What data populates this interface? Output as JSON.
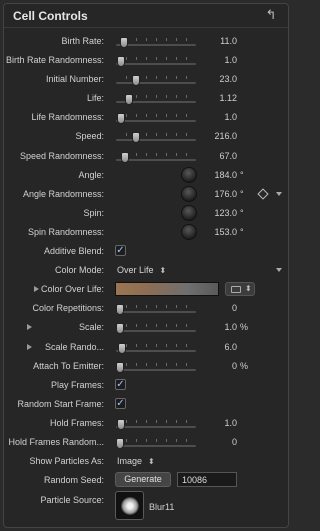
{
  "header": {
    "title": "Cell Controls",
    "reset_icon": "reset-arrow-icon",
    "reset_glyph": "↰"
  },
  "rows": {
    "birth_rate": {
      "label": "Birth Rate:",
      "value": "11.0",
      "slider_pos": 0.05
    },
    "birth_rate_randomness": {
      "label": "Birth Rate Randomness:",
      "value": "1.0",
      "slider_pos": 0.02
    },
    "initial_number": {
      "label": "Initial Number:",
      "value": "23.0",
      "slider_pos": 0.22
    },
    "life": {
      "label": "Life:",
      "value": "1.12",
      "slider_pos": 0.13
    },
    "life_randomness": {
      "label": "Life Randomness:",
      "value": "1.0",
      "slider_pos": 0.02
    },
    "speed": {
      "label": "Speed:",
      "value": "216.0",
      "slider_pos": 0.22
    },
    "speed_randomness": {
      "label": "Speed Randomness:",
      "value": "67.0",
      "slider_pos": 0.07
    },
    "angle": {
      "label": "Angle:",
      "value": "184.0",
      "unit": "°"
    },
    "angle_randomness": {
      "label": "Angle Randomness:",
      "value": "176.0",
      "unit": "°"
    },
    "spin": {
      "label": "Spin:",
      "value": "123.0",
      "unit": "°"
    },
    "spin_randomness": {
      "label": "Spin Randomness:",
      "value": "153.0",
      "unit": "°"
    },
    "additive_blend": {
      "label": "Additive Blend:",
      "checked": true
    },
    "color_mode": {
      "label": "Color Mode:",
      "value": "Over Life"
    },
    "color_over_life": {
      "label": "Color Over Life:"
    },
    "color_repetitions": {
      "label": "Color Repetitions:",
      "value": "0",
      "slider_pos": 0.0
    },
    "scale": {
      "label": "Scale:",
      "value": "1.0",
      "unit": "%",
      "slider_pos": 0.0
    },
    "scale_randomness": {
      "label": "Scale Rando...",
      "value": "6.0",
      "slider_pos": 0.03
    },
    "attach_to_emitter": {
      "label": "Attach To Emitter:",
      "value": "0",
      "unit": "%",
      "slider_pos": 0.0
    },
    "play_frames": {
      "label": "Play Frames:",
      "checked": true
    },
    "random_start_frame": {
      "label": "Random Start Frame:",
      "checked": true
    },
    "hold_frames": {
      "label": "Hold Frames:",
      "value": "1.0",
      "slider_pos": 0.02
    },
    "hold_frames_randomness": {
      "label": "Hold Frames Random...",
      "value": "0",
      "slider_pos": 0.0
    },
    "show_particles_as": {
      "label": "Show Particles As:",
      "value": "Image"
    },
    "random_seed": {
      "label": "Random Seed:",
      "button_label": "Generate",
      "value": "10086"
    },
    "particle_source": {
      "label": "Particle Source:",
      "value": "Blur11"
    }
  },
  "glyphs": {
    "check": "✓",
    "popup_arrow": "⬍",
    "menu_arrow": "▾"
  }
}
